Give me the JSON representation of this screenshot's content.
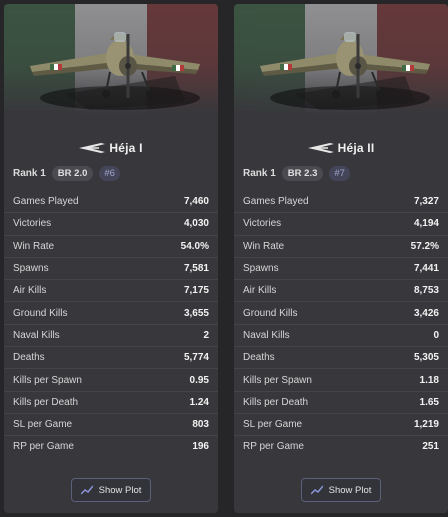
{
  "colors": {
    "flag_green": "#3e6b46",
    "flag_white": "#d8d8d8",
    "flag_red": "#8c3a3a",
    "card_bg": "#38383c",
    "page_bg": "#262628"
  },
  "vehicles": [
    {
      "name": "Héja I",
      "rank": "Rank 1",
      "br": "BR 2.0",
      "rank_number": "#6",
      "icon": "fighter-plane-icon",
      "stats": [
        {
          "label": "Games Played",
          "value": "7,460"
        },
        {
          "label": "Victories",
          "value": "4,030"
        },
        {
          "label": "Win Rate",
          "value": "54.0%"
        },
        {
          "label": "Spawns",
          "value": "7,581"
        },
        {
          "label": "Air Kills",
          "value": "7,175"
        },
        {
          "label": "Ground Kills",
          "value": "3,655"
        },
        {
          "label": "Naval Kills",
          "value": "2"
        },
        {
          "label": "Deaths",
          "value": "5,774"
        },
        {
          "label": "Kills per Spawn",
          "value": "0.95"
        },
        {
          "label": "Kills per Death",
          "value": "1.24"
        },
        {
          "label": "SL per Game",
          "value": "803"
        },
        {
          "label": "RP per Game",
          "value": "196"
        }
      ],
      "button": "Show Plot"
    },
    {
      "name": "Héja II",
      "rank": "Rank 1",
      "br": "BR 2.3",
      "rank_number": "#7",
      "icon": "fighter-plane-icon",
      "stats": [
        {
          "label": "Games Played",
          "value": "7,327"
        },
        {
          "label": "Victories",
          "value": "4,194"
        },
        {
          "label": "Win Rate",
          "value": "57.2%"
        },
        {
          "label": "Spawns",
          "value": "7,441"
        },
        {
          "label": "Air Kills",
          "value": "8,753"
        },
        {
          "label": "Ground Kills",
          "value": "3,426"
        },
        {
          "label": "Naval Kills",
          "value": "0"
        },
        {
          "label": "Deaths",
          "value": "5,305"
        },
        {
          "label": "Kills per Spawn",
          "value": "1.18"
        },
        {
          "label": "Kills per Death",
          "value": "1.65"
        },
        {
          "label": "SL per Game",
          "value": "1,219"
        },
        {
          "label": "RP per Game",
          "value": "251"
        }
      ],
      "button": "Show Plot"
    }
  ]
}
